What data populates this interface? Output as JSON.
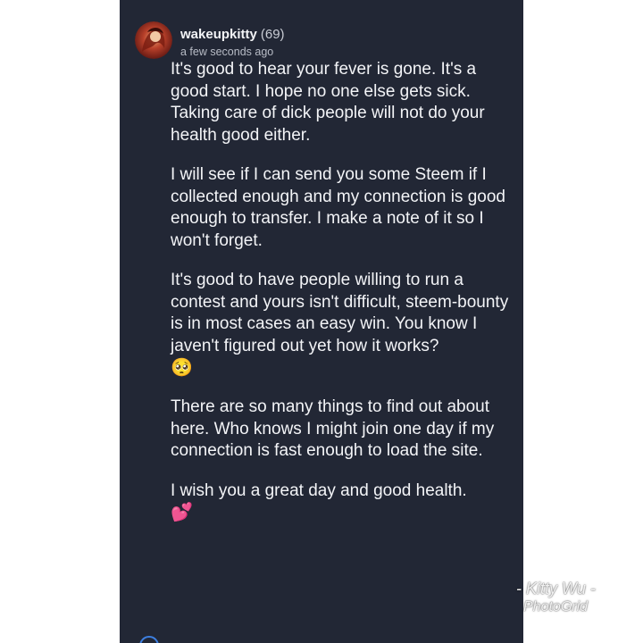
{
  "comment": {
    "author": "wakeupkitty",
    "reputation": "(69)",
    "timestamp": "a few seconds ago",
    "avatar_icon": "avatar-image",
    "paragraphs": [
      "It's good to hear your fever is gone. It's a good start. I hope no one else gets sick. Taking care of dick people will not do your health good either.",
      "I will see if I can send you some Steem if I collected enough and my connection is good enough to transfer. I make a note of it so I won't forget.",
      "It's good to have people willing to run a contest and yours isn't difficult, steem-bounty is in most cases an easy win. You know I javen't figured out yet how it works?",
      "There are so many things to find out about here. Who knows I might join one day if my connection is fast enough to load the site.",
      "I wish you a great day and good health."
    ],
    "emoji_pleading": "🥺",
    "emoji_hearts": "💕"
  },
  "watermark": {
    "line1": "- Kitty Wu -",
    "line2": "PhotoGrid"
  },
  "colors": {
    "panel_background": "#222735",
    "text": "#f3f4f7",
    "secondary_text": "#b8bcc6",
    "page_background": "#ffffff"
  }
}
